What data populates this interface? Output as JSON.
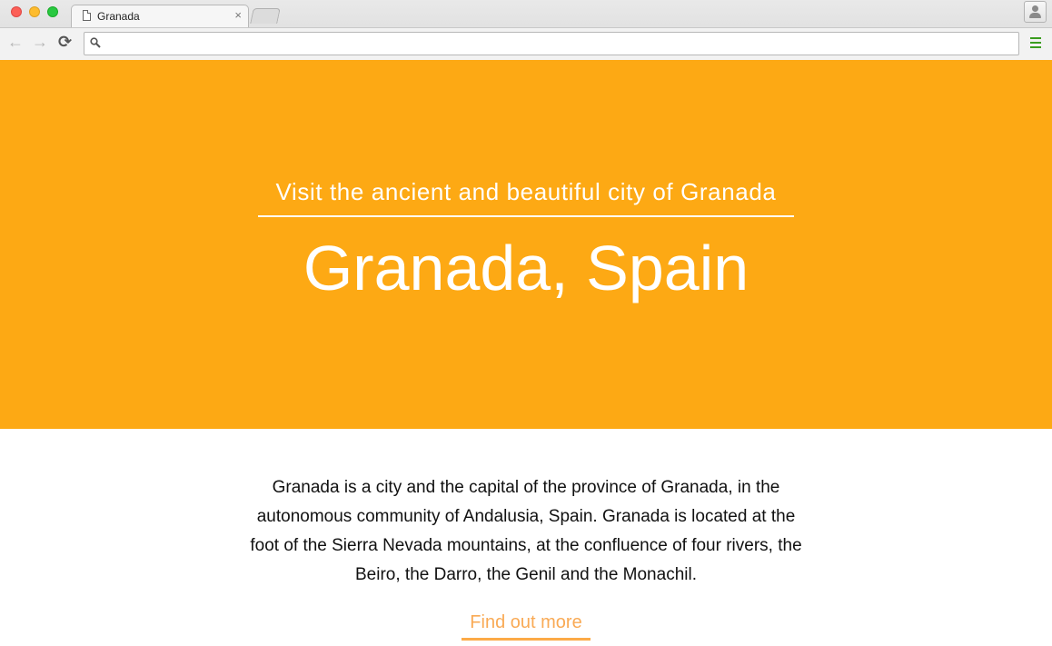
{
  "browser": {
    "tab": {
      "title": "Granada",
      "close_glyph": "×"
    },
    "toolbar": {
      "back_glyph": "←",
      "forward_glyph": "→",
      "reload_glyph": "⟳",
      "address_value": "",
      "address_placeholder": ""
    },
    "icons": {
      "page": "page-icon",
      "search": "search-icon",
      "menu": "hamburger-menu-icon",
      "profile": "person-icon"
    },
    "colors": {
      "menu_icon": "#3a9d1f"
    }
  },
  "hero": {
    "tagline": "Visit the ancient and beautiful city of Granada",
    "title": "Granada, Spain",
    "background": "#fda914"
  },
  "content": {
    "description": "Granada is a city and the capital of the province of Granada, in the autonomous community of Andalusia, Spain. Granada is located at the foot of the Sierra Nevada mountains, at the confluence of four rivers, the Beiro, the Darro, the Genil and the Monachil.",
    "cta_label": "Find out more",
    "cta_color": "#f9aa55"
  }
}
